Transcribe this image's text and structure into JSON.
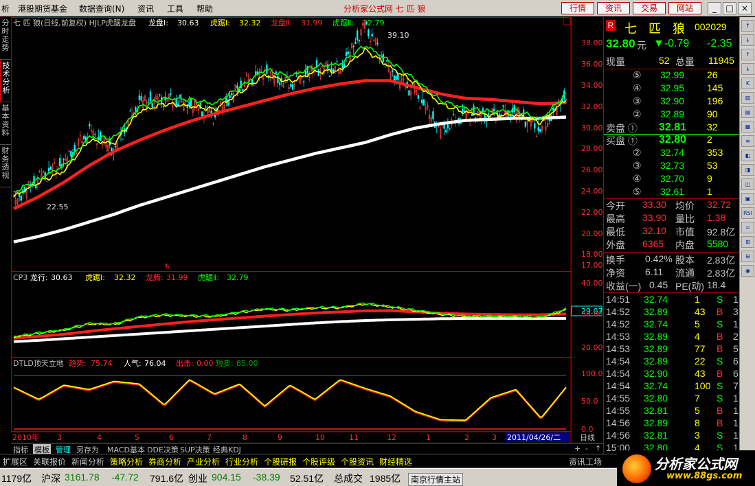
{
  "menu": {
    "items": [
      "析",
      "港股期货基金",
      "数据查询(N)",
      "资讯",
      "工具",
      "帮助"
    ],
    "app_title": "分析家公式网 七 匹 狼",
    "nav_buttons": [
      "行情",
      "资讯",
      "交易",
      "网站"
    ],
    "window_buttons": [
      "_",
      "□",
      "×"
    ]
  },
  "left_tabs": [
    "分时走势",
    "技术分析",
    "基本资料",
    "财务透视"
  ],
  "main_legend": {
    "prefix": "七 匹 狼(日线,前复权) HJLP虎踞龙盘",
    "items": [
      {
        "label": "龙盘Ⅰ:",
        "value": "30.63",
        "color": "#ffffff"
      },
      {
        "label": "虎踞Ⅰ:",
        "value": "32.32",
        "color": "#ffff00"
      },
      {
        "label": "龙盘Ⅱ:",
        "value": "31.99",
        "color": "#ff3030"
      },
      {
        "label": "虎踞Ⅱ:",
        "value": "32.79",
        "color": "#00ff00"
      }
    ]
  },
  "main_annotations": {
    "high": "39.10",
    "low": "22.55"
  },
  "cp3_legend": {
    "prefix": "CP3",
    "items": [
      {
        "label": "龙行:",
        "value": "30.63",
        "color": "#ffffff"
      },
      {
        "label": "虎踞Ⅰ:",
        "value": "32.32",
        "color": "#ffff00"
      },
      {
        "label": "龙腾:",
        "value": "31.99",
        "color": "#ff3030"
      },
      {
        "label": "虎踞Ⅱ:",
        "value": "32.79",
        "color": "#00ff00"
      }
    ],
    "marker": "29.07"
  },
  "dtld_legend": {
    "prefix": "DTLD顶天立地",
    "items": [
      {
        "label": "趋势:",
        "value": "75.74",
        "color": "#ff3030"
      },
      {
        "label": "人气:",
        "value": "76.04",
        "color": "#ffffff"
      },
      {
        "label": "出击:",
        "value": "0.00",
        "color": "#ff3030"
      },
      {
        "label": "短卖:",
        "value": "85.00",
        "color": "#00aa00"
      }
    ]
  },
  "axis": {
    "main_ticks": [
      "38.00",
      "36.00",
      "34.00",
      "32.00",
      "30.00",
      "28.00",
      "26.00",
      "24.00",
      "22.00",
      "20.00",
      "18.00",
      "17.00"
    ],
    "cp3_ticks": [
      "40.00",
      "30.00",
      "20.00"
    ],
    "dtld_ticks": [
      "100.0",
      "50.0",
      "0.0"
    ]
  },
  "time_axis": {
    "labels": [
      "2010年",
      "3",
      "4",
      "5",
      "6",
      "7",
      "8",
      "9",
      "10",
      "11",
      "12",
      "1",
      "2",
      "3"
    ],
    "cursor_date": "2011/04/26/二",
    "period": "日线"
  },
  "chart_data": {
    "type": "candlestick",
    "title": "七 匹 狼(日线,前复权) HJLP虎踞龙盘",
    "ylim": [
      17,
      39.5
    ],
    "x_range": [
      "2010-01",
      "2011-04-26"
    ],
    "series_main": [
      {
        "name": "龙盘Ⅰ",
        "color": "#ffffff",
        "values": [
          19.4,
          19.9,
          20.5,
          21.2,
          21.9,
          22.7,
          23.4,
          24.1,
          24.8,
          25.5,
          26.2,
          26.8,
          27.4,
          27.9,
          28.4,
          29.1,
          29.7,
          30.1,
          30.4,
          30.5,
          30.6,
          30.6,
          30.7
        ]
      },
      {
        "name": "龙盘Ⅱ",
        "color": "#ff2020",
        "values": [
          22.4,
          23.5,
          24.8,
          26.3,
          27.6,
          28.6,
          29.5,
          30.3,
          31.0,
          31.6,
          32.2,
          32.8,
          33.3,
          33.7,
          34.0,
          34.0,
          33.4,
          32.8,
          32.4,
          32.3,
          32.1,
          31.9,
          32.0
        ]
      },
      {
        "name": "虎踞Ⅰ",
        "color": "#ffff00",
        "values": [
          23.5,
          24.8,
          25.8,
          28.6,
          28.3,
          31.2,
          31.9,
          31.7,
          31.4,
          32.9,
          34.5,
          33.9,
          34.8,
          34.9,
          36.8,
          35.2,
          33.8,
          31.9,
          31.1,
          30.9,
          30.9,
          30.2,
          32.3
        ]
      },
      {
        "name": "虎踞Ⅱ",
        "color": "#00ff00",
        "values": [
          23.9,
          25.1,
          26.3,
          28.9,
          28.8,
          31.6,
          32.4,
          32.3,
          31.9,
          33.4,
          35.0,
          34.4,
          35.3,
          35.5,
          37.2,
          35.7,
          34.1,
          32.2,
          31.5,
          31.2,
          31.3,
          30.5,
          32.8
        ]
      }
    ],
    "price_close": [
      23.0,
      25.2,
      26.6,
      29.4,
      27.7,
      32.1,
      32.3,
      31.9,
      30.8,
      33.5,
      34.8,
      33.6,
      35.1,
      35.0,
      39.1,
      34.7,
      32.9,
      29.5,
      31.0,
      30.8,
      31.2,
      29.4,
      32.8
    ],
    "cp3": {
      "ylim": [
        15,
        45
      ],
      "lines": [
        {
          "name": "龙行",
          "color": "#ffffff",
          "values": [
            20.3,
            20.8,
            21.4,
            22.0,
            22.6,
            23.2,
            23.8,
            24.4,
            25.0,
            25.6,
            26.2,
            26.8,
            27.4,
            27.9,
            28.3,
            28.6,
            28.8,
            29.0,
            29.1,
            29.1,
            29.1,
            29.1,
            29.1
          ]
        },
        {
          "name": "龙腾",
          "color": "#ff2020",
          "values": [
            21.6,
            22.3,
            23.1,
            24.2,
            25.2,
            26.1,
            27.0,
            27.9,
            28.6,
            29.3,
            30.0,
            30.6,
            31.2,
            31.6,
            32.0,
            32.1,
            31.6,
            31.1,
            30.8,
            30.6,
            30.5,
            30.5,
            30.8
          ]
        },
        {
          "name": "虎踞Ⅰ",
          "color": "#ffff00",
          "values": [
            22.0,
            23.4,
            24.6,
            27.0,
            26.8,
            29.5,
            30.3,
            30.0,
            29.8,
            31.3,
            32.6,
            32.2,
            33.0,
            33.1,
            34.6,
            33.4,
            32.0,
            30.6,
            29.8,
            29.7,
            29.7,
            29.3,
            32.3
          ]
        },
        {
          "name": "虎踞Ⅱ",
          "color": "#00ff00",
          "values": [
            22.3,
            23.7,
            24.9,
            27.3,
            27.1,
            29.8,
            30.6,
            30.3,
            30.1,
            31.6,
            32.9,
            32.5,
            33.3,
            33.4,
            34.9,
            33.7,
            32.3,
            30.9,
            30.1,
            30.0,
            30.0,
            29.6,
            32.8
          ]
        }
      ]
    },
    "dtld": {
      "ylim": [
        0,
        100
      ],
      "lines": [
        {
          "name": "趋势",
          "color": "#ff2020",
          "values": [
            75,
            52,
            78,
            70,
            85,
            80,
            42,
            88,
            62,
            80,
            40,
            78,
            52,
            88,
            72,
            58,
            30,
            15,
            14,
            55,
            70,
            18,
            75
          ]
        },
        {
          "name": "人气",
          "color": "#ffff00",
          "values": [
            76,
            54,
            80,
            72,
            87,
            82,
            44,
            90,
            64,
            82,
            42,
            80,
            54,
            90,
            74,
            60,
            32,
            17,
            16,
            57,
            72,
            20,
            76
          ]
        }
      ]
    }
  },
  "quote": {
    "name": "七 匹 狼",
    "code": "002029",
    "price": "32.80",
    "unit": "元",
    "change": "▼-0.79",
    "change_pct": "-2.35",
    "vol_label": "现量",
    "vol": "52",
    "total_label": "总量",
    "total": "11945",
    "sell": [
      {
        "n": "⑤",
        "p": "32.99",
        "v": "26"
      },
      {
        "n": "④",
        "p": "32.95",
        "v": "145"
      },
      {
        "n": "③",
        "p": "32.90",
        "v": "196"
      },
      {
        "n": "②",
        "p": "32.89",
        "v": "90"
      },
      {
        "n": "卖盘 ①",
        "p": "32.81",
        "v": "32"
      }
    ],
    "buy": [
      {
        "n": "买盘 ①",
        "p": "32.80",
        "v": "2"
      },
      {
        "n": "②",
        "p": "32.74",
        "v": "353"
      },
      {
        "n": "③",
        "p": "32.73",
        "v": "53"
      },
      {
        "n": "④",
        "p": "32.70",
        "v": "9"
      },
      {
        "n": "⑤",
        "p": "32.61",
        "v": "1"
      }
    ],
    "stats": [
      {
        "l1": "今开",
        "v1": "33.30",
        "c1": "#ff3030",
        "l2": "均价",
        "v2": "32.72",
        "c2": "#ff3030"
      },
      {
        "l1": "最高",
        "v1": "33.90",
        "c1": "#ff3030",
        "l2": "量比",
        "v2": "1.38",
        "c2": "#ff3030"
      },
      {
        "l1": "最低",
        "v1": "32.10",
        "c1": "#ff3030",
        "l2": "市值",
        "v2": "92.8亿",
        "c2": "#c0c0c0"
      },
      {
        "l1": "外盘",
        "v1": "6365",
        "c1": "#ff3030",
        "l2": "内盘",
        "v2": "5580",
        "c2": "#00ff00"
      }
    ],
    "fin": [
      {
        "l1": "换手",
        "v1": "0.42%",
        "l2": "股本",
        "v2": "2.83亿"
      },
      {
        "l1": "净资",
        "v1": "6.11",
        "l2": "流通",
        "v2": "2.83亿"
      },
      {
        "l1": "收益(一)",
        "v1": "0.45",
        "l2": "PE(动)",
        "v2": "18.4"
      }
    ],
    "ticks": [
      {
        "t": "14:51",
        "p": "32.74",
        "v": "1",
        "d": "S",
        "n": "1"
      },
      {
        "t": "14:52",
        "p": "32.89",
        "v": "43",
        "d": "B",
        "n": "3"
      },
      {
        "t": "14:52",
        "p": "32.74",
        "v": "5",
        "d": "S",
        "n": "1"
      },
      {
        "t": "14:53",
        "p": "32.89",
        "v": "4",
        "d": "B",
        "n": "2"
      },
      {
        "t": "14:53",
        "p": "32.89",
        "v": "77",
        "d": "B",
        "n": "5"
      },
      {
        "t": "14:54",
        "p": "32.89",
        "v": "22",
        "d": "S",
        "n": "6"
      },
      {
        "t": "14:54",
        "p": "32.90",
        "v": "43",
        "d": "B",
        "n": "6"
      },
      {
        "t": "14:54",
        "p": "32.74",
        "v": "100",
        "d": "S",
        "n": "7"
      },
      {
        "t": "14:55",
        "p": "32.80",
        "v": "7",
        "d": "S",
        "n": "1"
      },
      {
        "t": "14:55",
        "p": "32.81",
        "v": "5",
        "d": "B",
        "n": "1"
      },
      {
        "t": "14:56",
        "p": "32.89",
        "v": "8",
        "d": "B",
        "n": "1"
      },
      {
        "t": "14:56",
        "p": "32.81",
        "v": "3",
        "d": "S",
        "n": "1"
      },
      {
        "t": "15:00",
        "p": "32.80",
        "v": "4",
        "d": "S",
        "n": "1"
      }
    ]
  },
  "bottom_tabs": [
    "指标",
    "模板",
    "管理",
    "另存为",
    "MACD基本",
    "DDE决策",
    "SUP决策",
    "经典KDJ"
  ],
  "bottom_right": {
    "plus": "+",
    "minus": "-",
    "arrow": "↑"
  },
  "func_bar": [
    "扩展区",
    "关联报价",
    "新闻分析",
    "策略分析",
    "券商分析",
    "产业分析",
    "行业分析",
    "个股研报",
    "个股评级",
    "个股资讯",
    "财经精选"
  ],
  "func_right": "资讯工场",
  "status": {
    "first": "1179亿",
    "hs_label": "沪深",
    "hs_value": "3161.78",
    "hs_change": "-47.72",
    "hs_amount": "791.6亿",
    "cy_label": "创业",
    "cy_value": "904.15",
    "cy_change": "-38.39",
    "cy_amount": "52.51亿",
    "total_label": "总成交",
    "total_value": "1985亿",
    "site": "南京行情主站"
  },
  "logo": {
    "text": "分析家公式网",
    "url": "www.88gs.com"
  },
  "right_toolbar": [
    "↑",
    "↓",
    "↑",
    "↓",
    "K",
    "▥",
    "▤",
    "▦",
    "≡",
    "◧",
    "◨",
    "◫",
    "▣",
    "RSI",
    "≈",
    "⊞",
    "⊟",
    "◉"
  ]
}
